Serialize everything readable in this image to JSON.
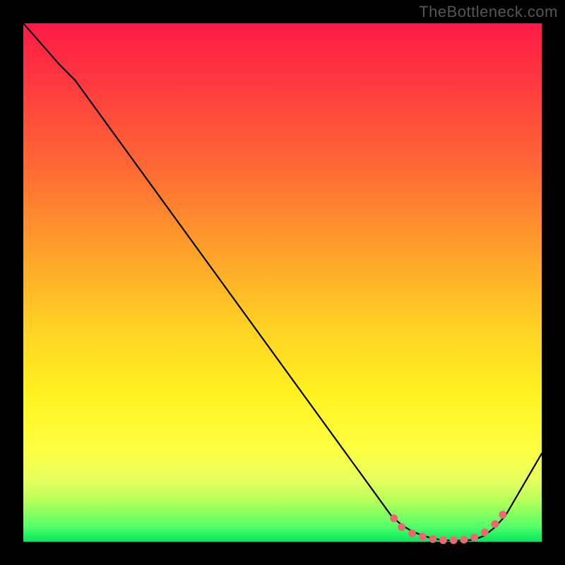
{
  "watermark": "TheBottleneck.com",
  "chart_data": {
    "type": "line",
    "title": "",
    "xlabel": "",
    "ylabel": "",
    "xlim": [
      0,
      100
    ],
    "ylim": [
      0,
      100
    ],
    "series": [
      {
        "name": "curve",
        "x": [
          0,
          7,
          10,
          71,
          73,
          75,
          77,
          79,
          81,
          83,
          85,
          87,
          89,
          91,
          93,
          100
        ],
        "y": [
          100,
          92,
          89,
          5,
          3.2,
          2.0,
          1.2,
          0.6,
          0.3,
          0.2,
          0.2,
          0.4,
          1.2,
          2.8,
          5.0,
          17
        ]
      }
    ],
    "markers": {
      "name": "points",
      "x": [
        71.5,
        73,
        75,
        77,
        79,
        81,
        83,
        85,
        87,
        89,
        91,
        92.5
      ],
      "y": [
        4.5,
        2.8,
        1.6,
        1.0,
        0.5,
        0.3,
        0.3,
        0.4,
        0.8,
        1.8,
        3.4,
        5.2
      ]
    }
  }
}
